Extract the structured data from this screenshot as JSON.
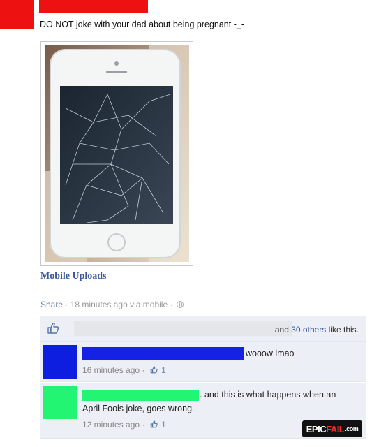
{
  "post": {
    "author_avatar_color": "#ee1111",
    "status_text": "DO NOT joke with your dad about being pregnant -_-",
    "photo": {
      "subject": "phone with shattered screen",
      "album_label": "Mobile Uploads"
    },
    "meta": {
      "share_label": "Share",
      "separator": "·",
      "timestamp": "18 minutes ago via mobile",
      "audience_icon": "globe-icon"
    }
  },
  "likes": {
    "thumb_icon": "thumbs-up-icon",
    "prefix": "and",
    "others_link": "30 others",
    "suffix": "like this."
  },
  "comments": [
    {
      "avatar_color": "#0d1ee0",
      "text": "wooow lmao",
      "timestamp": "16 minutes ago",
      "like_count": "1"
    },
    {
      "avatar_color": "#22f571",
      "text_line1": ". and this is what happens when an",
      "text_line2": "April Fools joke, goes wrong.",
      "timestamp": "12 minutes ago",
      "like_count": "1"
    }
  ],
  "watermark": {
    "part1": "EPIC",
    "part2": "FAIL",
    "part3": ".com"
  }
}
